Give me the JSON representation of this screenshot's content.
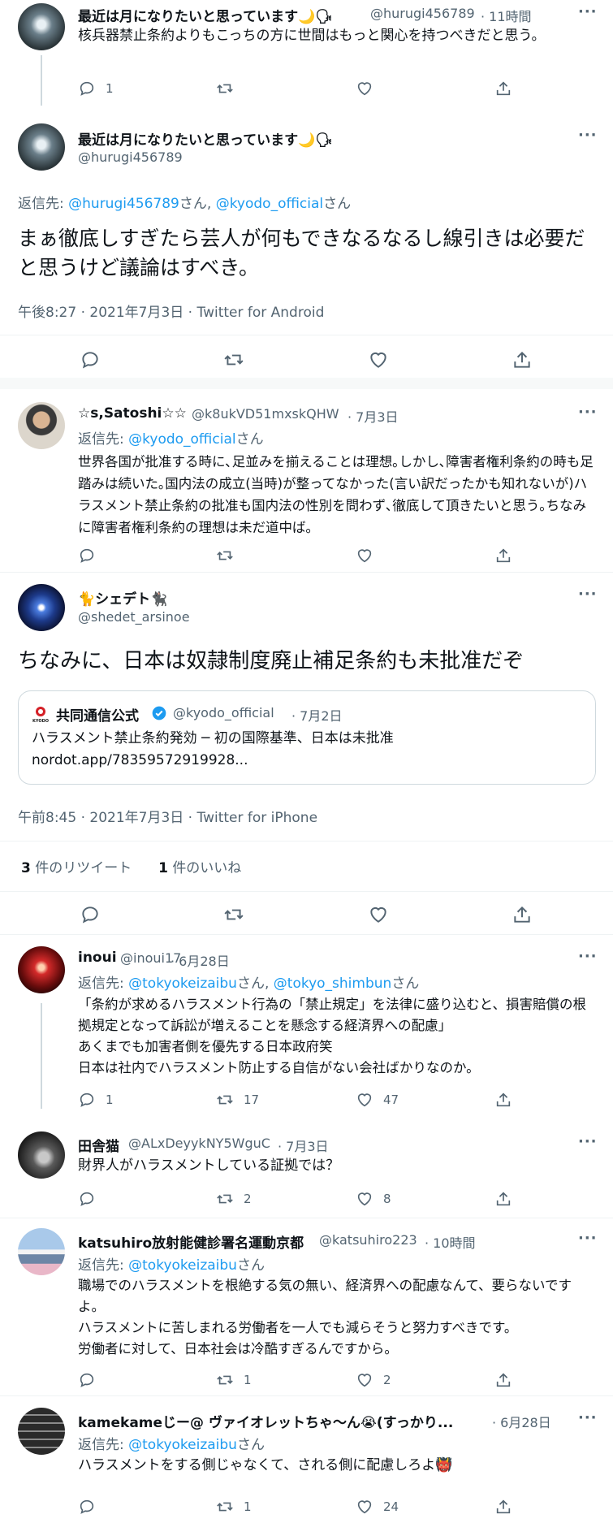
{
  "colors": {
    "link": "#1d9bf0",
    "secondary": "#536471",
    "border": "#eff3f4",
    "verified": "#1d9bf0"
  },
  "tweet1": {
    "name": "最近は月になりたいと思っています🌙🗣",
    "handle": "@hurugi456789",
    "time": "· 11時間",
    "more": "···",
    "text": "核兵器禁止条約よりもこっちの方に世間はもっと関心を持つべきだと思う。",
    "replies": "1"
  },
  "tweet2": {
    "name": "最近は月になりたいと思っています🌙🗣",
    "handle": "@hurugi456789",
    "more": "···",
    "reply_prefix": "返信先:",
    "reply_to_1": "@hurugi456789",
    "san_1": "さん,",
    "reply_to_2": "@kyodo_official",
    "san_2": "さん",
    "text": "まぁ徹底しすぎたら芸人が何もできなるなるし線引きは必要だと思うけど議論はすべき。",
    "meta": "午後8:27 · 2021年7月3日 · Twitter for Android"
  },
  "tweet3": {
    "name": "☆s,Satoshi☆☆",
    "handle": "@k8ukVD51mxskQHW",
    "time": "· 7月3日",
    "more": "···",
    "reply_prefix": "返信先:",
    "reply_to": "@kyodo_official",
    "san": "さん",
    "text": "世界各国が批准する時に､足並みを揃えることは理想｡しかし､障害者権利条約の時も足踏みは続いた｡国内法の成立(当時)が整ってなかった(言い訳だったかも知れないが)ハラスメント禁止条約の批准も国内法の性別を問わず､徹底して頂きたいと思う｡ちなみに障害者権利条約の理想は未だ道中ば｡"
  },
  "tweet4": {
    "name": "🐈シェデト🐈‍⬛",
    "handle": "@shedet_arsinoe",
    "more": "···",
    "text": "ちなみに、日本は奴隷制度廃止補足条約も未批准だぞ",
    "quote": {
      "logo_text": "KYODO",
      "name": "共同通信公式",
      "handle": "@kyodo_official",
      "time": "· 7月2日",
      "line1": "ハラスメント禁止条約発効 ─ 初の国際基準、日本は未批准",
      "line2": "nordot.app/78359572919928..."
    },
    "meta": "午前8:45 · 2021年7月3日 · Twitter for iPhone",
    "retweets_count": "3",
    "retweets_label": "件のリツイート",
    "likes_count": "1",
    "likes_label": "件のいいね"
  },
  "tweet5": {
    "name": "inoui",
    "handle": "@inoui17",
    "time": "· 6月28日",
    "more": "···",
    "reply_prefix": "返信先:",
    "reply_to_1": "@tokyokeizaibu",
    "san_1": "さん,",
    "reply_to_2": "@tokyo_shimbun",
    "san_2": "さん",
    "line1": "「条約が求めるハラスメント行為の「禁止規定」を法律に盛り込むと、損害賠償の根拠規定となって訴訟が増えることを懸念する経済界への配慮」",
    "line2": "あくまでも加害者側を優先する日本政府笑",
    "line3": "日本は社内でハラスメント防止する自信がない会社ばかりなのか。",
    "replies": "1",
    "retweets": "17",
    "likes": "47"
  },
  "tweet6": {
    "name": "田舎猫",
    "handle": "@ALxDeyykNY5WguC",
    "time": "· 7月3日",
    "more": "···",
    "text": "財界人がハラスメントしている証拠では？",
    "retweets": "2",
    "likes": "8"
  },
  "tweet7": {
    "name": "katsuhiro放射能健診署名運動京都",
    "handle": "@katsuhiro223",
    "time": "· 10時間",
    "more": "···",
    "reply_prefix": "返信先:",
    "reply_to": "@tokyokeizaibu",
    "san": "さん",
    "line1": "職場でのハラスメントを根絶する気の無い、経済界への配慮なんて、要らないですよ。",
    "line2": "ハラスメントに苦しまれる労働者を一人でも減らそうと努力すべきです。",
    "line3": "労働者に対して、日本社会は冷酷すぎるんですから。",
    "retweets": "1",
    "likes": "2"
  },
  "tweet8": {
    "name": "kamekameじー@ ヴァイオレットちゃ〜ん😭(すっかり...",
    "time": "· 6月28日",
    "more": "···",
    "reply_prefix": "返信先:",
    "reply_to": "@tokyokeizaibu",
    "san": "さん",
    "text": "ハラスメントをする側じゃなくて、される側に配慮しろよ👹",
    "retweets": "1",
    "likes": "24"
  }
}
